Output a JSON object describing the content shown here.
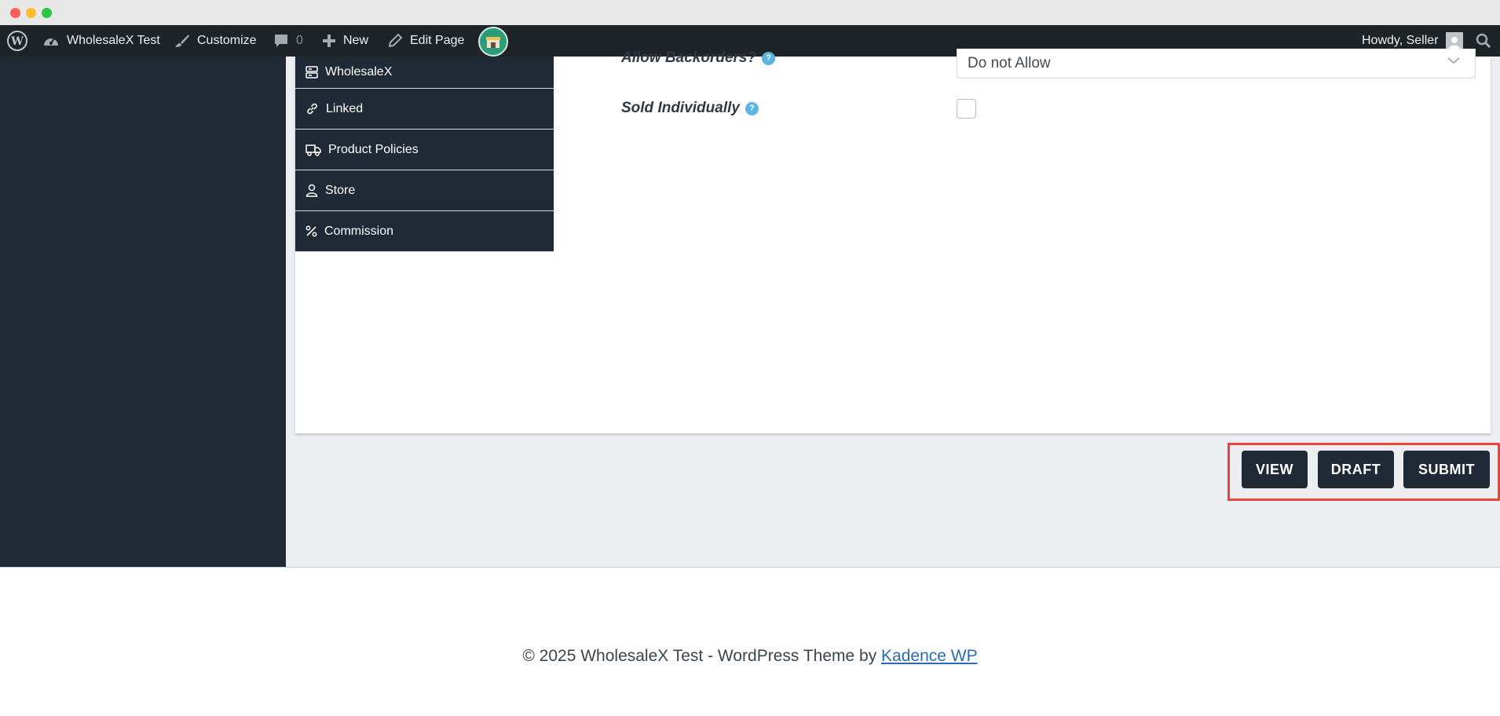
{
  "admin_bar": {
    "site_name": "WholesaleX Test",
    "customize_label": "Customize",
    "comments_count": "0",
    "new_label": "New",
    "edit_page_label": "Edit Page",
    "greeting": "Howdy, Seller"
  },
  "tabs": [
    {
      "label": "WholesaleX",
      "icon": "server-icon"
    },
    {
      "label": "Linked",
      "icon": "link-icon"
    },
    {
      "label": "Product Policies",
      "icon": "truck-icon"
    },
    {
      "label": "Store",
      "icon": "user-icon"
    },
    {
      "label": "Commission",
      "icon": "percent-icon"
    }
  ],
  "fields": {
    "backorders_label": "Allow Backorders?",
    "backorders_value": "Do not Allow",
    "sold_individually_label": "Sold Individually",
    "sold_individually_checked": false,
    "help_icon": "?"
  },
  "actions": {
    "view_label": "VIEW",
    "draft_label": "DRAFT",
    "submit_label": "SUBMIT"
  },
  "footer": {
    "text": "© 2025 WholesaleX Test - WordPress Theme by ",
    "link_text": "Kadence WP"
  },
  "colors": {
    "admin_bar_bg": "#1d2327",
    "sidebar_bg": "#1d2934",
    "button_bg": "#1f2a36",
    "highlight_frame": "#e8443a",
    "help_dot": "#5bb5e0"
  }
}
